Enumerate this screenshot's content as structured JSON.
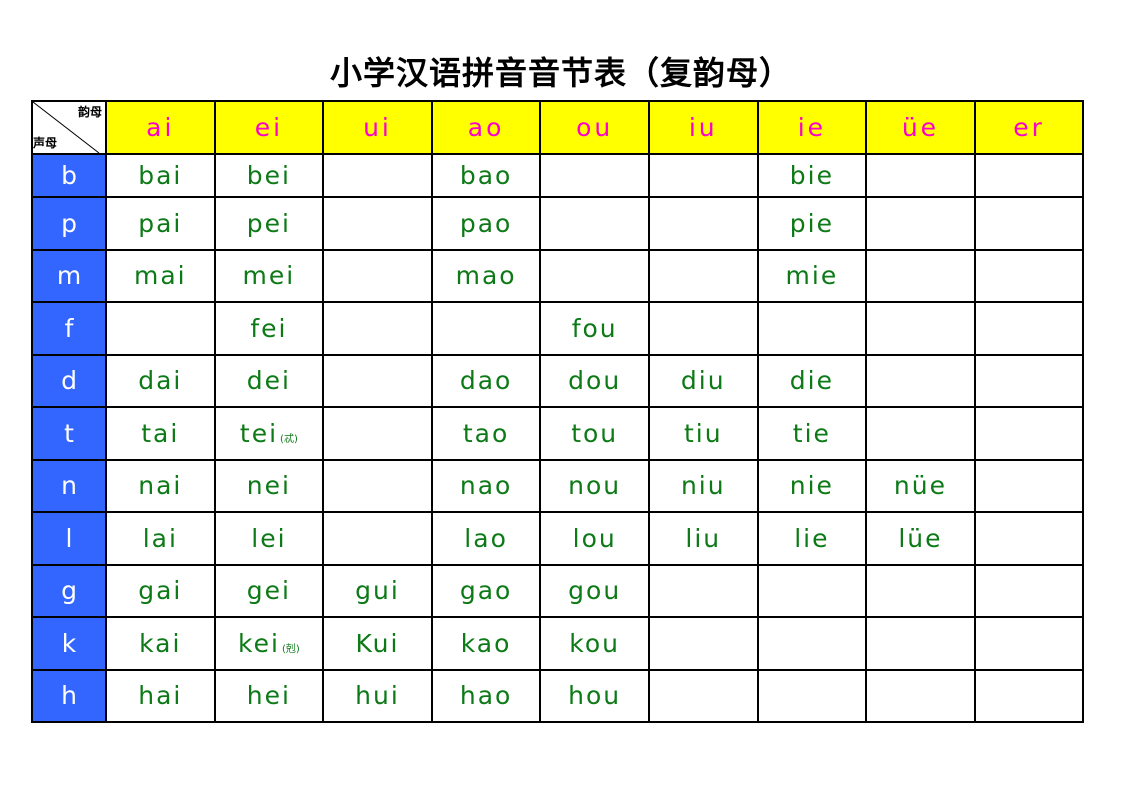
{
  "title": "小学汉语拼音音节表（复韵母）",
  "corner": {
    "top_right_label": "韵母",
    "bottom_left_label": "声母"
  },
  "finals": [
    "ai",
    "ei",
    "ui",
    "ao",
    "ou",
    "iu",
    "ie",
    "üe",
    "er"
  ],
  "rows": [
    {
      "initial": "b",
      "cells": [
        "bai",
        "bei",
        "",
        "bao",
        "",
        "",
        "bie",
        "",
        ""
      ]
    },
    {
      "initial": "p",
      "cells": [
        "pai",
        "pei",
        "",
        "pao",
        "",
        "",
        "pie",
        "",
        ""
      ]
    },
    {
      "initial": "m",
      "cells": [
        "mai",
        "mei",
        "",
        "mao",
        "",
        "",
        "mie",
        "",
        ""
      ]
    },
    {
      "initial": "f",
      "cells": [
        "",
        "fei",
        "",
        "",
        "fou",
        "",
        "",
        "",
        ""
      ]
    },
    {
      "initial": "d",
      "cells": [
        "dai",
        "dei",
        "",
        "dao",
        "dou",
        "diu",
        "die",
        "",
        ""
      ]
    },
    {
      "initial": "t",
      "cells": [
        "tai",
        "tei",
        "",
        "tao",
        "tou",
        "tiu",
        "tie",
        "",
        ""
      ]
    },
    {
      "initial": "n",
      "cells": [
        "nai",
        "nei",
        "",
        "nao",
        "nou",
        "niu",
        "nie",
        "nüe",
        ""
      ]
    },
    {
      "initial": "l",
      "cells": [
        "lai",
        "lei",
        "",
        "lao",
        "lou",
        "liu",
        "lie",
        "lüe",
        ""
      ]
    },
    {
      "initial": "g",
      "cells": [
        "gai",
        "gei",
        "gui",
        "gao",
        "gou",
        "",
        "",
        "",
        ""
      ]
    },
    {
      "initial": "k",
      "cells": [
        "kai",
        "kei",
        "Kui",
        "kao",
        "kou",
        "",
        "",
        "",
        ""
      ]
    },
    {
      "initial": "h",
      "cells": [
        "hai",
        "hei",
        "hui",
        "hao",
        "hou",
        "",
        "",
        "",
        ""
      ]
    }
  ],
  "notes": {
    "5": {
      "1": "(忒)"
    },
    "9": {
      "1": "(剋)"
    }
  },
  "colors": {
    "header_bg": "#ffff00",
    "header_text": "#ff00cc",
    "initial_bg": "#3366ff",
    "cell_text": "#0d7a17"
  }
}
